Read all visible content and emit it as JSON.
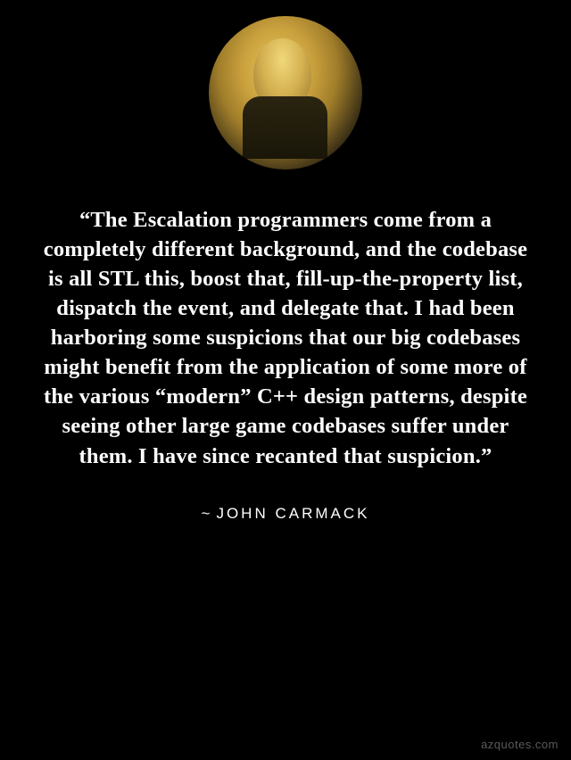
{
  "quote": {
    "text": "“The Escalation programmers come from a completely different background, and the codebase is all STL this, boost that, fill-up-the-property list, dispatch the event, and delegate that. I had been harboring some suspicions that our big codebases might benefit from the application of some more of the various “modern” C++ design patterns, despite seeing other large game codebases suffer under them. I have since recanted that suspicion.”"
  },
  "author": {
    "prefix": "~",
    "name": "JOHN CARMACK"
  },
  "watermark": "azquotes.com"
}
